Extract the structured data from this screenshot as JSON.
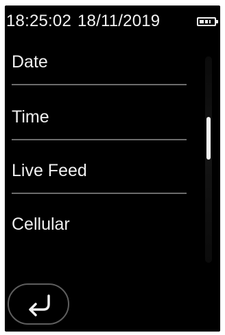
{
  "status_bar": {
    "time": "18:25:02",
    "date": "18/11/2019",
    "battery_icon": "battery-icon",
    "battery_level": 0.8
  },
  "menu": {
    "items": [
      {
        "label": "Date"
      },
      {
        "label": "Time"
      },
      {
        "label": "Live Feed"
      },
      {
        "label": "Cellular"
      }
    ]
  },
  "scrollbar": {
    "position": 0.35
  },
  "footer": {
    "back_icon": "return-arrow-icon"
  },
  "colors": {
    "background": "#000000",
    "text": "#f0f0f0",
    "divider": "#6c6c6c",
    "button_border": "#5e5e5e"
  }
}
